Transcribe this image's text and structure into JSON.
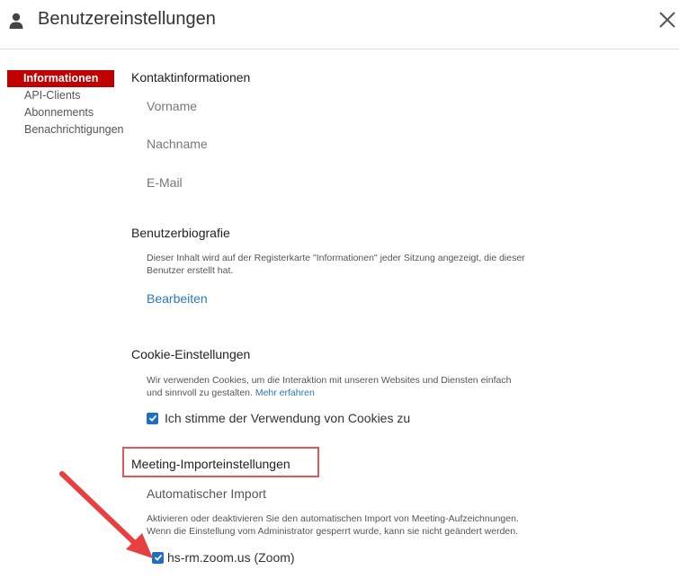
{
  "header": {
    "title": "Benutzereinstellungen"
  },
  "sidebar": {
    "items": [
      {
        "label": "Informationen",
        "active": true
      },
      {
        "label": "API-Clients"
      },
      {
        "label": "Abonnements"
      },
      {
        "label": "Benachrichtigungen"
      }
    ]
  },
  "contact": {
    "title": "Kontaktinformationen",
    "firstname_label": "Vorname",
    "lastname_label": "Nachname",
    "email_label": "E-Mail"
  },
  "bio": {
    "title": "Benutzerbiografie",
    "desc_line1": "Dieser Inhalt wird auf der Registerkarte \"Informationen\" jeder Sitzung angezeigt, die dieser",
    "desc_line2": "Benutzer erstellt hat.",
    "edit_label": "Bearbeiten"
  },
  "cookies": {
    "title": "Cookie-Einstellungen",
    "desc_line1": "Wir verwenden Cookies, um die Interaktion mit unseren Websites und Diensten einfach",
    "desc_line2": "und sinnvoll zu gestalten.",
    "more_link": "Mehr erfahren",
    "consent_label": "Ich stimme der Verwendung von Cookies zu",
    "consent_checked": true
  },
  "meeting_import": {
    "title": "Meeting-Importeinstellungen",
    "subtitle": "Automatischer Import",
    "desc_line1": "Aktivieren oder deaktivieren Sie den automatischen Import von Meeting-Aufzeichnungen.",
    "desc_line2": "Wenn die Einstellung vom Administrator gesperrt wurde, kann sie nicht geändert werden.",
    "source_label": "hs-rm.zoom.us (Zoom)",
    "source_checked": true
  },
  "colors": {
    "accent": "#c00000",
    "link": "#2a7ab8",
    "highlight": "#e05858",
    "checkbox": "#1e6fbf"
  }
}
